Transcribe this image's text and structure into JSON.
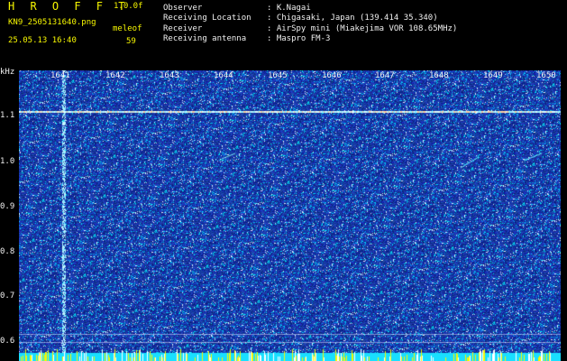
{
  "header": {
    "app_name": "H R O F F T",
    "version": "1.0.0f",
    "filename": "KN9_2505131640.png",
    "datetime": "25.05.13 16:40",
    "mode_label": "meleof",
    "mode_value": "59",
    "info_labels": [
      "Observer",
      "Receiving Location",
      "Receiver",
      "Receiving antenna"
    ],
    "info_values": [
      ": K.Nagai",
      ": Chigasaki, Japan (139.414 35.340)",
      ": AirSpy mini (Miakejima VOR 108.65MHz)",
      ": Maspro FM-3"
    ]
  },
  "axis": {
    "y_unit": "kHz",
    "y_ticks": [
      "1.1",
      "1.0",
      "0.9",
      "0.8",
      "0.7",
      "0.6"
    ],
    "x_ticks": [
      "1641",
      "1642",
      "1643",
      "1644",
      "1645",
      "1646",
      "1647",
      "1648",
      "1649",
      "1650"
    ]
  },
  "colors": {
    "label_yellow": "#f7f700",
    "label_white": "#f0f0f0",
    "background": "#000000",
    "spectrum_base": "#1a3fc8",
    "spectrum_noise": "#00c8ff",
    "floor_band": "#19dfff"
  }
}
